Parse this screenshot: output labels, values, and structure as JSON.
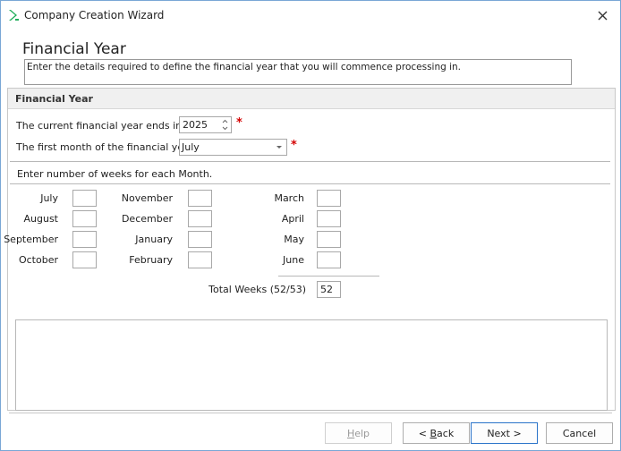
{
  "window": {
    "title": "Company Creation Wizard"
  },
  "page": {
    "heading": "Financial Year",
    "description": "Enter the details required to define the financial year that you will commence processing in."
  },
  "panel": {
    "header": "Financial Year",
    "current_year_label": "The current financial year ends in",
    "current_year_value": "2025",
    "first_month_label": "The first month of the financial year is",
    "first_month_value": "July",
    "required_marker": "*",
    "weeks_instruction": "Enter number of weeks for each Month.",
    "months": [
      {
        "name": "July",
        "weeks": ""
      },
      {
        "name": "August",
        "weeks": ""
      },
      {
        "name": "September",
        "weeks": ""
      },
      {
        "name": "October",
        "weeks": ""
      },
      {
        "name": "November",
        "weeks": ""
      },
      {
        "name": "December",
        "weeks": ""
      },
      {
        "name": "January",
        "weeks": ""
      },
      {
        "name": "February",
        "weeks": ""
      },
      {
        "name": "March",
        "weeks": ""
      },
      {
        "name": "April",
        "weeks": ""
      },
      {
        "name": "May",
        "weeks": ""
      },
      {
        "name": "June",
        "weeks": ""
      }
    ],
    "total_label": "Total Weeks (52/53)",
    "total_value": "52"
  },
  "buttons": {
    "help": {
      "pre": "",
      "key": "H",
      "post": "elp"
    },
    "back": {
      "pre": "< ",
      "key": "B",
      "post": "ack"
    },
    "next": "Next >",
    "cancel": "Cancel"
  },
  "colors": {
    "accent": "#2a73c9",
    "required": "#d40000",
    "logo": "#1fae5b"
  }
}
